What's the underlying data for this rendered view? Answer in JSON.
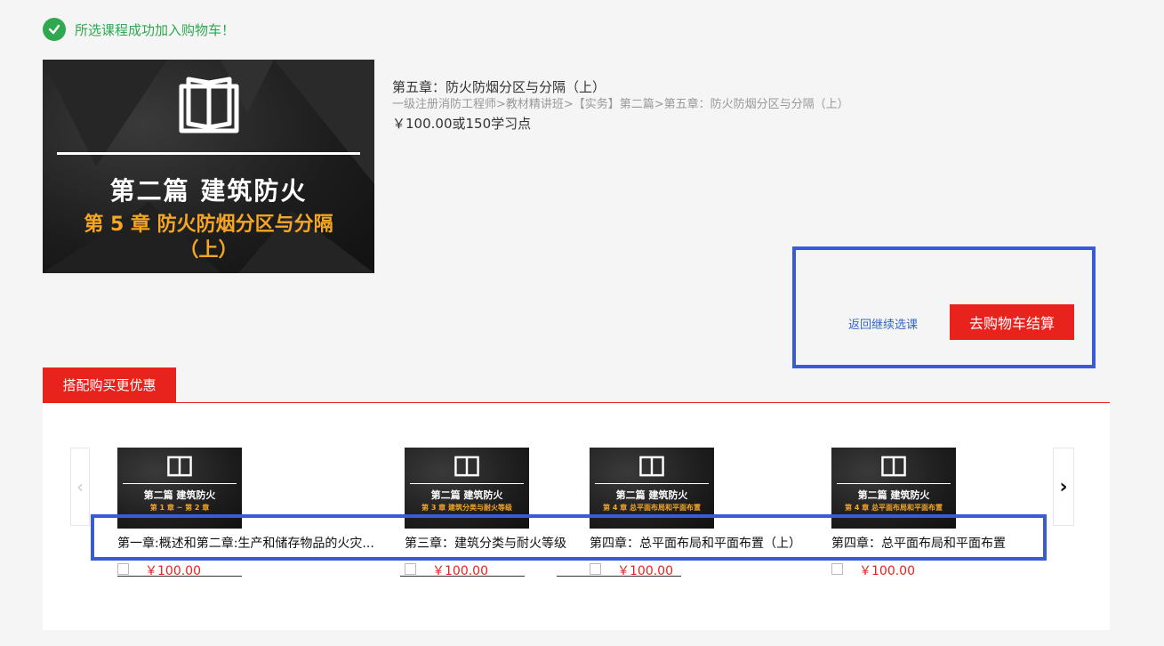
{
  "success": {
    "message": "所选课程成功加入购物车！",
    "color": "#2fa84f"
  },
  "cover": {
    "line1": "第二篇  建筑防火",
    "line2": "第 5 章  防火防烟分区与分隔",
    "line3": "（上）"
  },
  "course": {
    "title": "第五章：防火防烟分区与分隔（上）",
    "path": "一级注册消防工程师>教材精讲班>【实务】第二篇>第五章：防火防烟分区与分隔（上）",
    "price": "￥100.00或150学习点"
  },
  "actions": {
    "back_label": "返回继续选课",
    "checkout_label": "去购物车结算"
  },
  "combo": {
    "tab_label": "搭配购买更优惠",
    "items": [
      {
        "thumb_title": "第二篇  建筑防火",
        "thumb_sub": "第 1 章 ~ 第 2 章",
        "name": "第一章:概述和第二章:生产和储存物品的火灾...",
        "price": "￥100.00"
      },
      {
        "thumb_title": "第二篇  建筑防火",
        "thumb_sub": "第 3 章  建筑分类与耐火等级",
        "name": "第三章：建筑分类与耐火等级",
        "price": "￥100.00"
      },
      {
        "thumb_title": "第二篇  建筑防火",
        "thumb_sub": "第 4 章  总平面布局和平面布置",
        "name": "第四章：总平面布局和平面布置（上）",
        "price": "￥100.00"
      },
      {
        "thumb_title": "第二篇  建筑防火",
        "thumb_sub": "第 4 章  总平面布局和平面布置",
        "name": "第四章：总平面布局和平面布置",
        "price": "￥100.00"
      }
    ]
  },
  "colors": {
    "accent": "#e8231e",
    "highlight": "#3b5bd6",
    "cover_orange": "#f5a623"
  }
}
